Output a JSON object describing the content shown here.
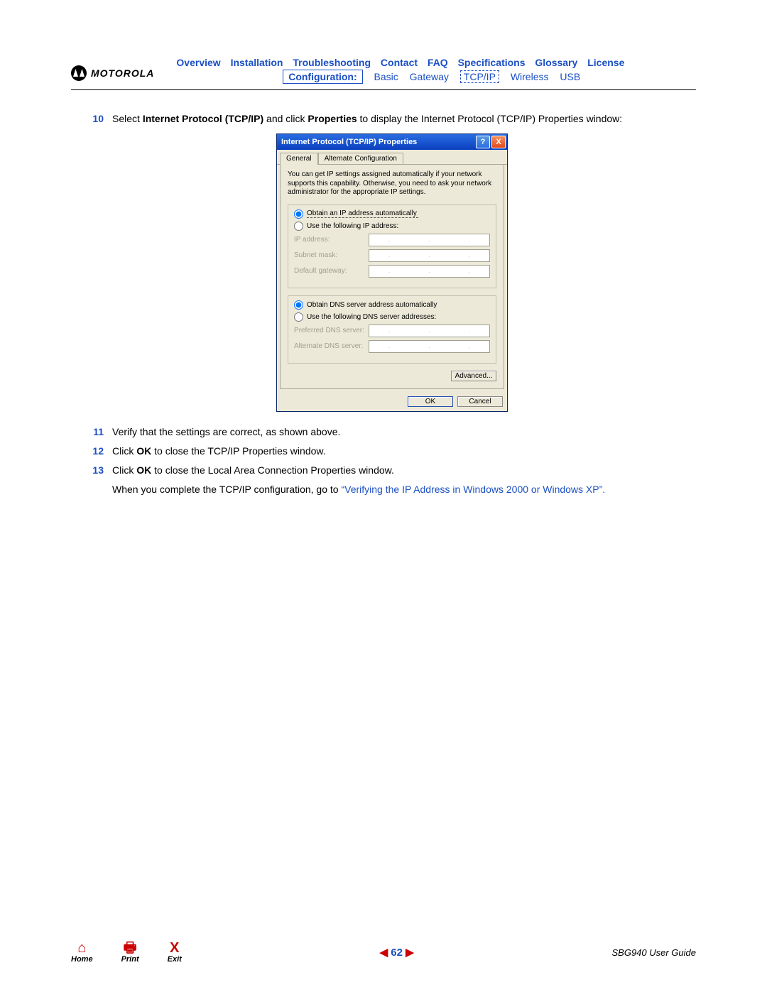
{
  "header": {
    "brand": "MOTOROLA",
    "nav1": [
      "Overview",
      "Installation",
      "Troubleshooting",
      "Contact",
      "FAQ",
      "Specifications",
      "Glossary",
      "License"
    ],
    "config_label": "Configuration:",
    "nav2": [
      "Basic",
      "Gateway",
      "TCP/IP",
      "Wireless",
      "USB"
    ]
  },
  "steps": {
    "s10": {
      "num": "10",
      "pre": "Select ",
      "b1": "Internet Protocol (TCP/IP)",
      "mid": " and click ",
      "b2": "Properties",
      "post": " to display the Internet Protocol (TCP/IP) Properties window:"
    },
    "s11": {
      "num": "11",
      "text": "Verify that the settings are correct, as shown above."
    },
    "s12": {
      "num": "12",
      "pre": "Click ",
      "b1": "OK",
      "post": " to close the TCP/IP Properties window."
    },
    "s13": {
      "num": "13",
      "pre": "Click ",
      "b1": "OK",
      "post": " to close the Local Area Connection Properties window."
    },
    "closing": {
      "pre": "When you complete the TCP/IP configuration, go to ",
      "q1": "“",
      "link": "Verifying the IP Address in Windows 2000 or Windows XP",
      "q2": "”."
    }
  },
  "dialog": {
    "title": "Internet Protocol (TCP/IP) Properties",
    "tabs": {
      "general": "General",
      "alt": "Alternate Configuration"
    },
    "info": "You can get IP settings assigned automatically if your network supports this capability. Otherwise, you need to ask your network administrator for the appropriate IP settings.",
    "radio_obtain_ip": "Obtain an IP address automatically",
    "radio_use_ip": "Use the following IP address:",
    "lbl_ip": "IP address:",
    "lbl_subnet": "Subnet mask:",
    "lbl_gateway": "Default gateway:",
    "radio_obtain_dns": "Obtain DNS server address automatically",
    "radio_use_dns": "Use the following DNS server addresses:",
    "lbl_pref_dns": "Preferred DNS server:",
    "lbl_alt_dns": "Alternate DNS server:",
    "btn_advanced": "Advanced...",
    "btn_ok": "OK",
    "btn_cancel": "Cancel"
  },
  "footer": {
    "home": "Home",
    "print": "Print",
    "exit": "Exit",
    "page_num": "62",
    "guide": "SBG940 User Guide"
  }
}
